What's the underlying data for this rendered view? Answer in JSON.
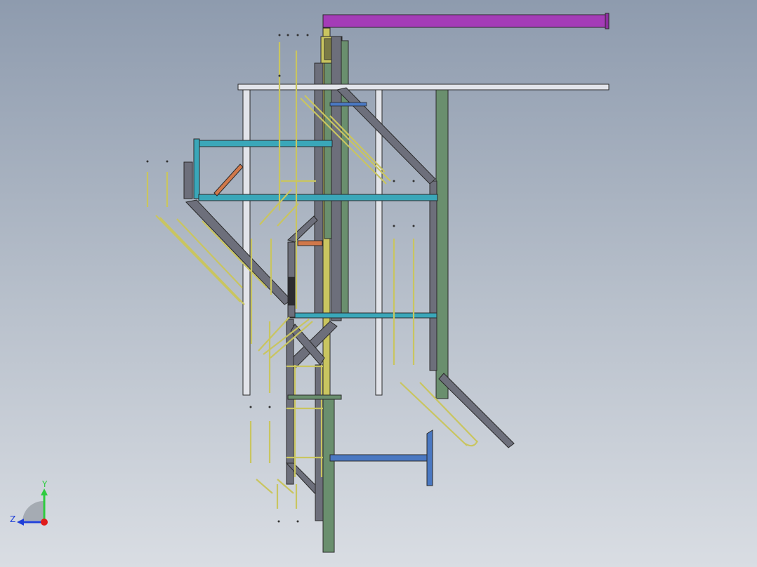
{
  "view": {
    "background_top": "#8e9bae",
    "background_bottom": "#d9dde3"
  },
  "colors": {
    "purple_beam": "#a43cb7",
    "white_beam": "#e2e4ea",
    "green_column": "#6a8f6e",
    "teal_beam": "#3aa7b9",
    "dark_grey": "#6d6f7b",
    "yellow_rail": "#c9c560",
    "orange_brace": "#d1784a",
    "blue_beam": "#4a78c2",
    "outline": "#2a2a2a"
  },
  "triad": {
    "y_label": "Y",
    "z_label": "Z",
    "y_color": "#2ecc40",
    "z_color": "#1f3fd8",
    "x_color": "#e01b1b"
  }
}
